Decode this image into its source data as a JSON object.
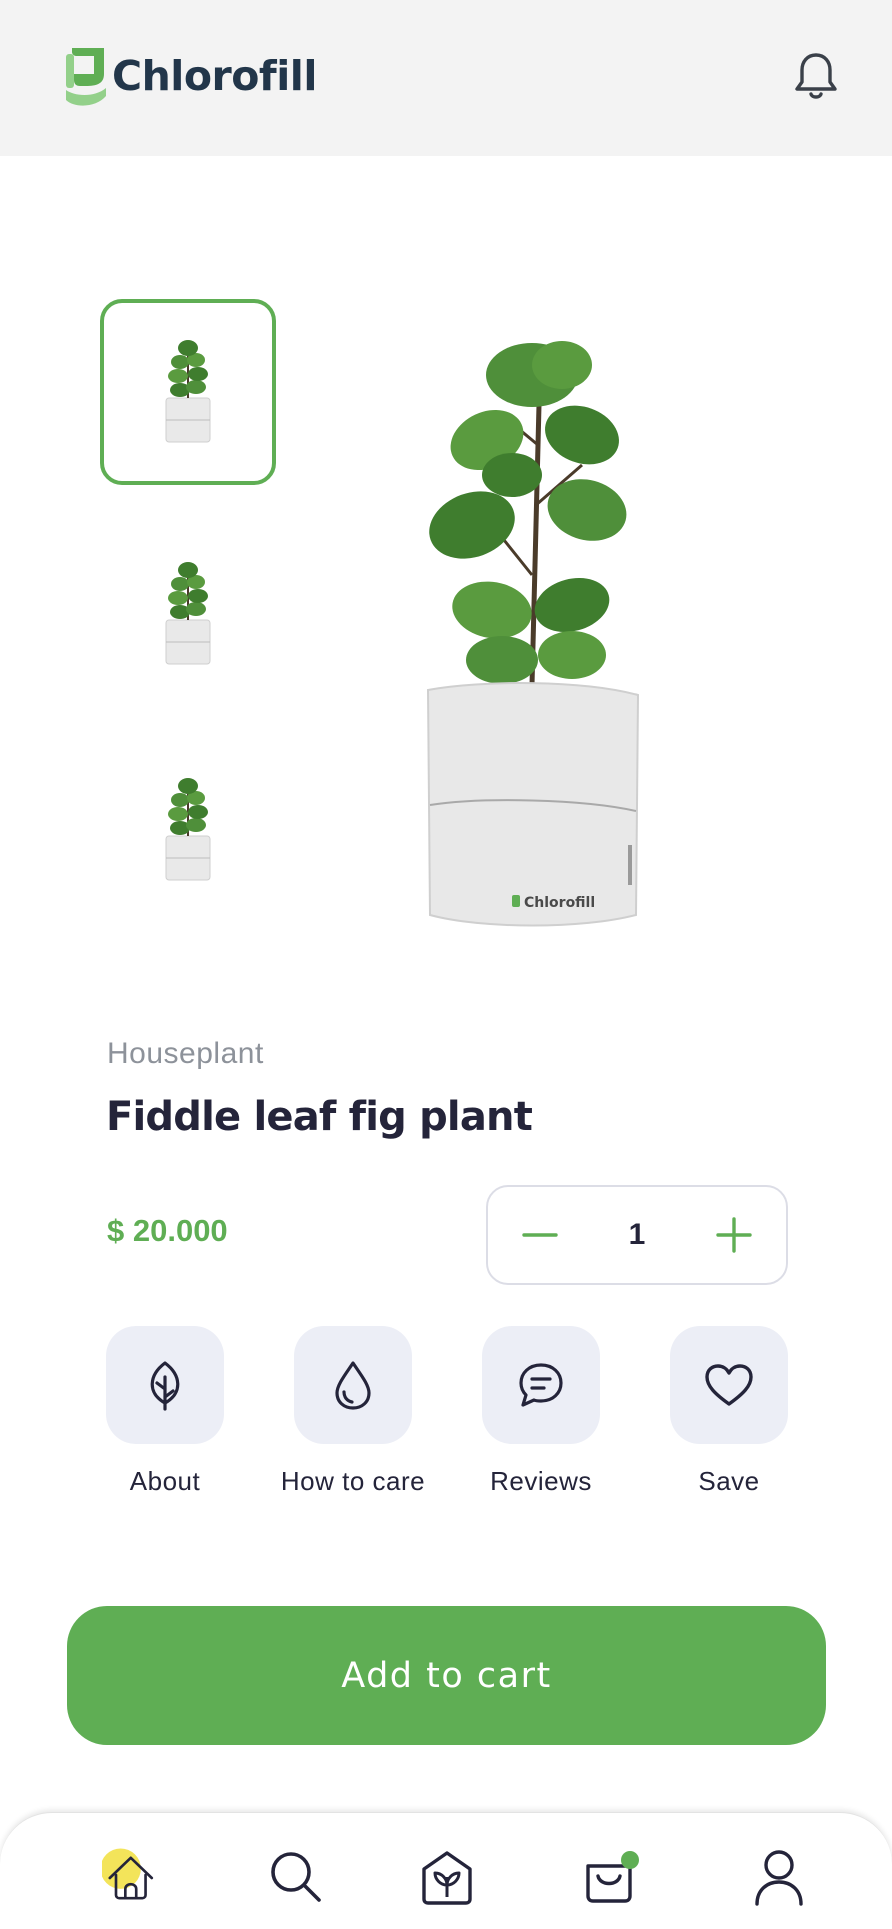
{
  "app": {
    "name": "Chlorofill"
  },
  "header": {
    "notification_icon": "bell-icon"
  },
  "product": {
    "category": "Houseplant",
    "name": "Fiddle leaf fig plant",
    "price": "$ 20.000",
    "quantity": "1",
    "pot_brand": "Chlorofill"
  },
  "actions": [
    {
      "label": "About",
      "icon": "leaf-icon"
    },
    {
      "label": "How to care",
      "icon": "water-drop-icon"
    },
    {
      "label": "Reviews",
      "icon": "chat-icon"
    },
    {
      "label": "Save",
      "icon": "heart-icon"
    }
  ],
  "cart": {
    "label": "Add to cart"
  },
  "nav": [
    {
      "icon": "home-icon",
      "active": true
    },
    {
      "icon": "search-icon"
    },
    {
      "icon": "plant-house-icon"
    },
    {
      "icon": "cart-icon",
      "badge": true
    },
    {
      "icon": "profile-icon"
    }
  ],
  "colors": {
    "brand_green": "#5fae54",
    "dark_text": "#24243a",
    "muted_text": "#8d929a",
    "tile_bg": "#eceef6",
    "header_bg": "#f3f3f3",
    "active_highlight": "#f3e45a",
    "logo_text": "#22364a"
  }
}
